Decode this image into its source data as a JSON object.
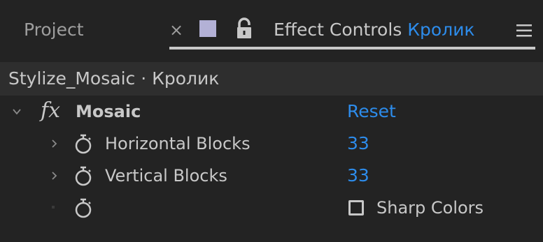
{
  "tabs": {
    "project_label": "Project",
    "close_glyph": "×",
    "effect_controls_label": "Effect Controls",
    "layer_name": "Кролик",
    "swatch_color": "#b3b1d6",
    "accent_color": "#2d8ceb"
  },
  "breadcrumb": {
    "text": "Stylize_Mosaic · Кролик"
  },
  "effect": {
    "fx_badge": "fx",
    "name": "Mosaic",
    "reset_label": "Reset",
    "expanded": true
  },
  "properties": [
    {
      "label": "Horizontal Blocks",
      "value": "33"
    },
    {
      "label": "Vertical Blocks",
      "value": "33"
    }
  ],
  "sharp_colors": {
    "label": "Sharp Colors",
    "checked": false
  },
  "icons": [
    "close-icon",
    "lock-icon",
    "panel-menu-icon",
    "chevron-down-icon",
    "chevron-right-icon",
    "stopwatch-icon",
    "checkbox-icon"
  ]
}
